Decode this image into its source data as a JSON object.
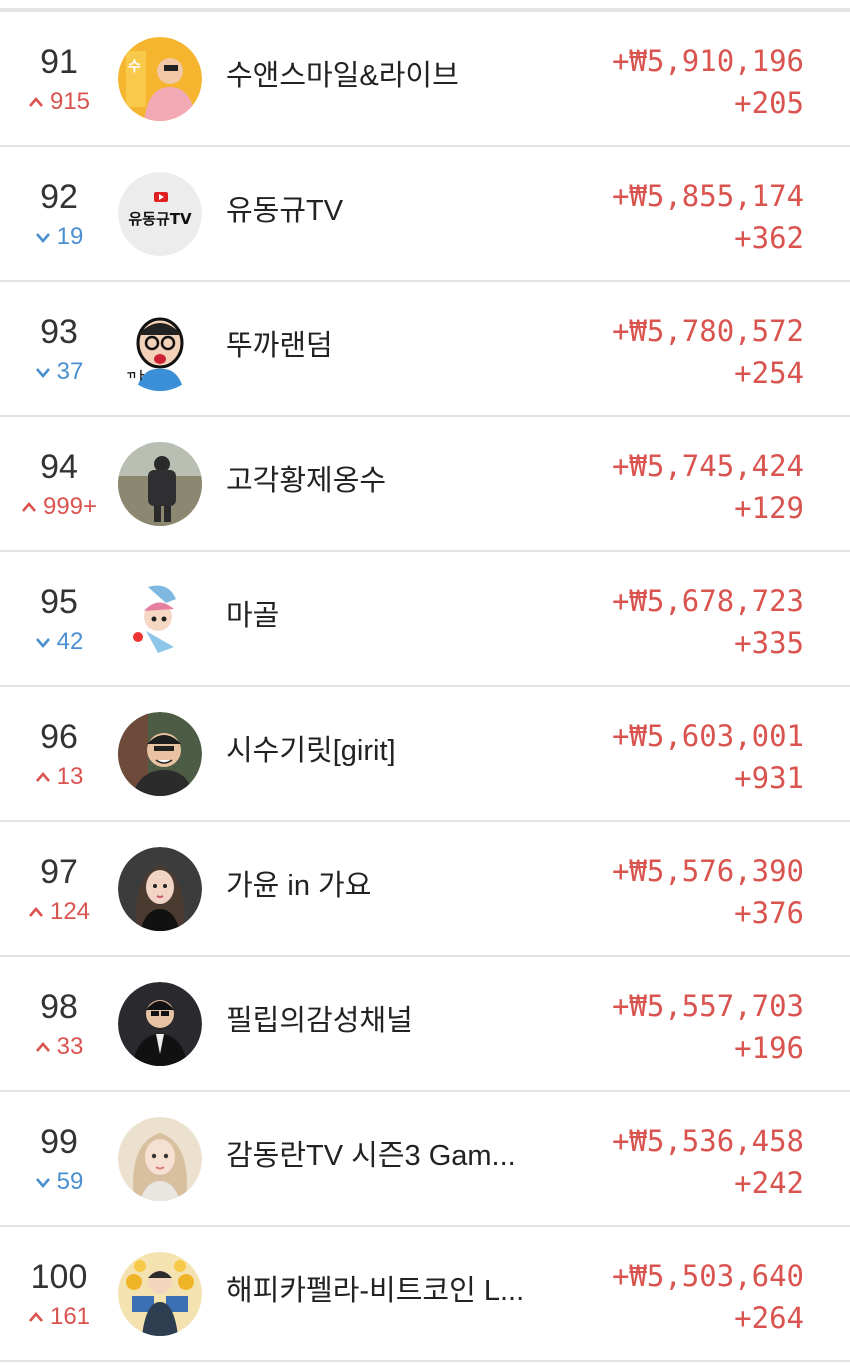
{
  "rows": [
    {
      "rank": "91",
      "direction": "up",
      "change": "915",
      "name": "수앤스마일&라이브",
      "amount": "+₩5,910,196",
      "delta": "+205",
      "avatar_bg": "#f5b52e"
    },
    {
      "rank": "92",
      "direction": "down",
      "change": "19",
      "name": "유동규TV",
      "amount": "+₩5,855,174",
      "delta": "+362",
      "avatar_bg": "#ececec",
      "avatar_text": "유동규TV"
    },
    {
      "rank": "93",
      "direction": "down",
      "change": "37",
      "name": "뚜까랜덤",
      "amount": "+₩5,780,572",
      "delta": "+254",
      "avatar_bg": "#ffffff"
    },
    {
      "rank": "94",
      "direction": "up",
      "change": "999+",
      "name": "고각황제옹수",
      "amount": "+₩5,745,424",
      "delta": "+129",
      "avatar_bg": "#8b8f7a"
    },
    {
      "rank": "95",
      "direction": "down",
      "change": "42",
      "name": "마골",
      "amount": "+₩5,678,723",
      "delta": "+335",
      "avatar_bg": "#ffffff"
    },
    {
      "rank": "96",
      "direction": "up",
      "change": "13",
      "name": "시수기릿[girit]",
      "amount": "+₩5,603,001",
      "delta": "+931",
      "avatar_bg": "#5a6b4f"
    },
    {
      "rank": "97",
      "direction": "up",
      "change": "124",
      "name": "가윤 in 가요",
      "amount": "+₩5,576,390",
      "delta": "+376",
      "avatar_bg": "#3c3c3c"
    },
    {
      "rank": "98",
      "direction": "up",
      "change": "33",
      "name": "필립의감성채널",
      "amount": "+₩5,557,703",
      "delta": "+196",
      "avatar_bg": "#2a2a2e"
    },
    {
      "rank": "99",
      "direction": "down",
      "change": "59",
      "name": "감동란TV 시즌3 Gam...",
      "amount": "+₩5,536,458",
      "delta": "+242",
      "avatar_bg": "#e9d9c4"
    },
    {
      "rank": "100",
      "direction": "up",
      "change": "161",
      "name": "해피카펠라-비트코인 L...",
      "amount": "+₩5,503,640",
      "delta": "+264",
      "avatar_bg": "#f2d27a"
    }
  ],
  "colors": {
    "up": "#d9534f",
    "down": "#4a8fd0",
    "amount": "#d9534f"
  }
}
